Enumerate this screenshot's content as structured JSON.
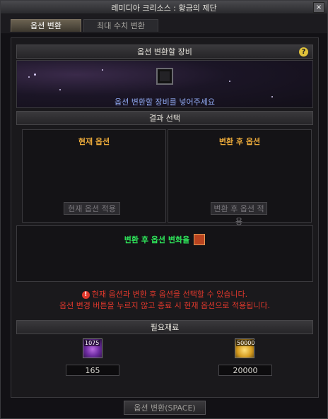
{
  "window": {
    "title": "레미디아 크리소스 : 황금의 제단",
    "close_label": "×"
  },
  "tabs": [
    {
      "label": "옵션 변환"
    },
    {
      "label": "최대 수치 변환"
    }
  ],
  "equip": {
    "header": "옵션 변환할 장비",
    "help_label": "?",
    "instruction": "옵션 변환할 장비를 넣어주세요"
  },
  "result": {
    "header": "결과 선택",
    "current": {
      "title": "현재 옵션",
      "button": "현재 옵션 적용"
    },
    "converted": {
      "title": "변환 후 옵션",
      "button": "변환 후 옵션 적용"
    }
  },
  "after_convert": {
    "message": "변환 후 옵션 변화율"
  },
  "warning": {
    "line1": "현재 옵션과 변환 후 옵션을 선택할 수 있습니다.",
    "line2": "옵션 변경 버튼을 누르지 않고 종료 시 현재 옵션으로 적용됩니다.",
    "icon_label": "!"
  },
  "materials": {
    "header": "필요재료",
    "items": [
      {
        "icon": "purple-orb-icon",
        "owned": "1075",
        "required": "165"
      },
      {
        "icon": "gold-coins-icon",
        "owned": "50000",
        "required": "20000"
      }
    ]
  },
  "convert_button": "옵션 변환(SPACE)",
  "colors": {
    "accent_gold": "#e8a83a",
    "green": "#2ee55a",
    "warning_red": "#e0382c",
    "info_blue": "#8fa8f0"
  }
}
